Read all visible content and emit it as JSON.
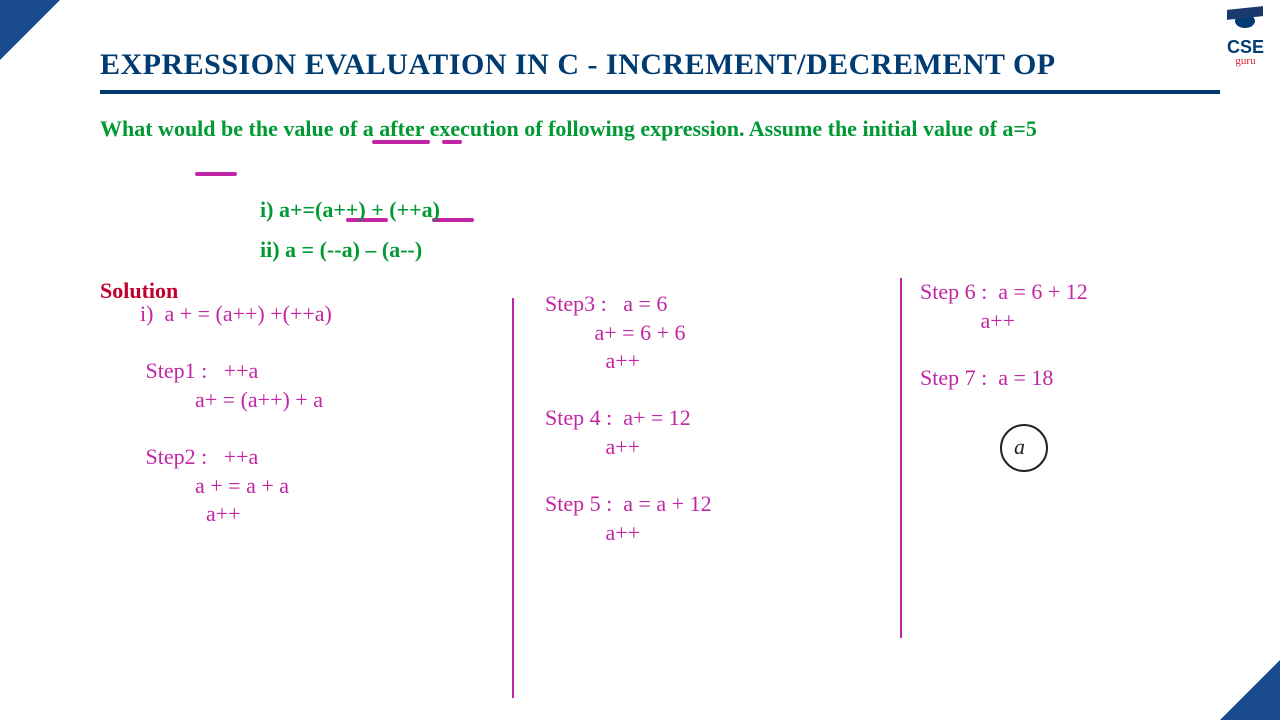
{
  "logo": {
    "text": "CSE",
    "sub": "guru"
  },
  "title": "EXPRESSION EVALUATION IN C - INCREMENT/DECREMENT OP",
  "question": "What would be the value of a after execution of following expression. Assume the initial value of a=5",
  "parts": {
    "i": "i) a+=(a++) + (++a)",
    "ii": "ii) a = (--a) – (a--)"
  },
  "solution_label": "Solution",
  "handwriting": {
    "col1": "i)  a + = (a++) +(++a)\n\n Step1 :   ++a\n          a+ = (a++) + a\n\n Step2 :   ++a\n          a + = a + a\n            a++",
    "col2": "Step3 :   a = 6\n         a+ = 6 + 6\n           a++\n\nStep 4 :  a+ = 12\n           a++\n\nStep 5 :  a = a + 12\n           a++",
    "col3": "Step 6 :  a = 6 + 12\n           a++\n\nStep 7 :  a = 18"
  },
  "cursor_text": "a"
}
